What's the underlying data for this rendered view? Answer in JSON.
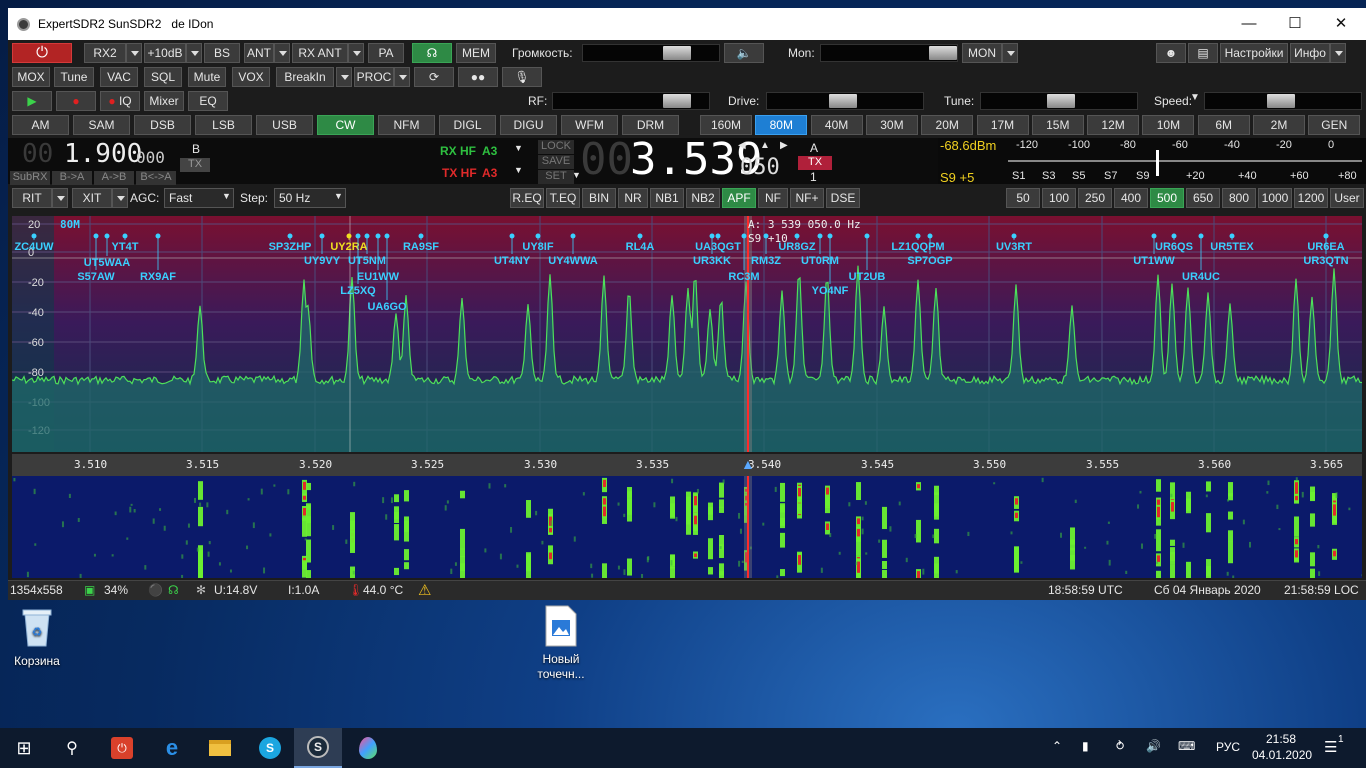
{
  "window": {
    "title": "ExpertSDR2 SunSDR2",
    "subtitle": "de IDon"
  },
  "row1": {
    "power": "⏻",
    "rx2": "RX2",
    "gain": "+10dB",
    "bs": "BS",
    "ant": "ANT",
    "rxant": "RX ANT",
    "pa": "PA",
    "mem": "MEM",
    "volume_label": "Громкость:",
    "mon_label": "Mon:",
    "mon": "MON",
    "settings": "Настройки",
    "info": "Инфо"
  },
  "row2": {
    "mox": "MOX",
    "tune": "Tune",
    "vac": "VAC",
    "sql": "SQL",
    "mute": "Mute",
    "vox": "VOX",
    "breakin": "BreakIn",
    "proc": "PROC"
  },
  "row3": {
    "iq": "IQ",
    "mixer": "Mixer",
    "eq": "EQ",
    "rf_label": "RF:",
    "drive_label": "Drive:",
    "tune_label": "Tune:",
    "speed_label": "Speed:"
  },
  "modes": [
    "AM",
    "SAM",
    "DSB",
    "LSB",
    "USB",
    "CW",
    "NFM",
    "DIGL",
    "DIGU",
    "WFM",
    "DRM"
  ],
  "active_mode": "CW",
  "bands": [
    "160M",
    "80M",
    "40M",
    "30M",
    "20M",
    "17M",
    "15M",
    "12M",
    "10M",
    "6M",
    "2M",
    "GEN"
  ],
  "active_band": "80M",
  "vfo": {
    "sub_dim": "00",
    "sub_main": "1.900",
    "sub_small": "000",
    "sub_b": "B",
    "sub_tx": "TX",
    "subrx": "SubRX",
    "b_a": "B->A",
    "a_b": "A->B",
    "b_swap": "B<->A",
    "rxhf": "RX HF",
    "rxhf_ant": "A3",
    "txhf": "TX HF",
    "txhf_ant": "A3",
    "lock": "LOCK",
    "save": "SAVE",
    "set": "SET",
    "main_dim": "00",
    "main": "3.539",
    "main_small": "050",
    "vfo_a": "A",
    "vfo_tx": "TX",
    "vfo_num": "1"
  },
  "meter": {
    "dbm": "-68.6dBm",
    "s_reading": "S9 +5",
    "top_scale": [
      "-120",
      "-100",
      "-80",
      "-60",
      "-40",
      "-20",
      "0"
    ],
    "bottom_scale": [
      "S1",
      "S3",
      "S5",
      "S7",
      "S9",
      "+20",
      "+40",
      "+60",
      "+80"
    ]
  },
  "row5": {
    "rit": "RIT",
    "xit": "XIT",
    "agc_label": "AGC:",
    "agc": "Fast",
    "step_label": "Step:",
    "step": "50 Hz",
    "dsp": [
      "R.EQ",
      "T.EQ",
      "BIN",
      "NR",
      "NB1",
      "NB2",
      "APF",
      "NF",
      "NF+",
      "DSE"
    ],
    "active_dsp": "APF",
    "filters": [
      "50",
      "100",
      "250",
      "400",
      "500",
      "650",
      "800",
      "1000",
      "1200",
      "User"
    ],
    "active_filter": "500"
  },
  "spectrum": {
    "band_label": "80M",
    "ylabels": [
      "20",
      "0",
      "-20",
      "-40",
      "-60",
      "-80",
      "-100",
      "-120"
    ],
    "cursor_readout": "A: 3 539 050.0 Hz",
    "cursor_level": "S9 +10",
    "freq_labels": [
      "3.510",
      "3.515",
      "3.520",
      "3.525",
      "3.530",
      "3.535",
      "3.540",
      "3.545",
      "3.550",
      "3.555",
      "3.560",
      "3.565"
    ],
    "spots": [
      "ZC4UW",
      "YT4T",
      "UT5WAA",
      "S57AW",
      "RX9AF",
      "SP3ZHP",
      "UY9VY",
      "UY2RA",
      "UT5NM",
      "EU1WW",
      "LZ5XQ",
      "UA6GO",
      "RA9SF",
      "UT4NY",
      "UY8IF",
      "UY4WWA",
      "RL4A",
      "UA3QGT",
      "UR3KK",
      "RC3M",
      "RM3Z",
      "UR8GZ",
      "UT0RM",
      "YO4NF",
      "UT2UB",
      "LZ1QQPM",
      "SP7OGP",
      "UV3RT",
      "UR6QS",
      "UT1WW",
      "UR5TEX",
      "UR4UC",
      "UR6EA",
      "UR3QTN"
    ]
  },
  "status": {
    "resolution": "1354x558",
    "cpu": "34%",
    "voltage": "U:14.8V",
    "current": "I:1.0A",
    "temp": "44.0 °C",
    "utc": "18:58:59 UTC",
    "date": "Сб 04 Январь 2020",
    "local": "21:58:59 LOC"
  },
  "desktop": {
    "recycle": "Корзина",
    "newfile1": "Новый",
    "newfile2": "точечн..."
  },
  "taskbar": {
    "lang": "РУС",
    "time": "21:58",
    "date": "04.01.2020",
    "notif": "1"
  }
}
